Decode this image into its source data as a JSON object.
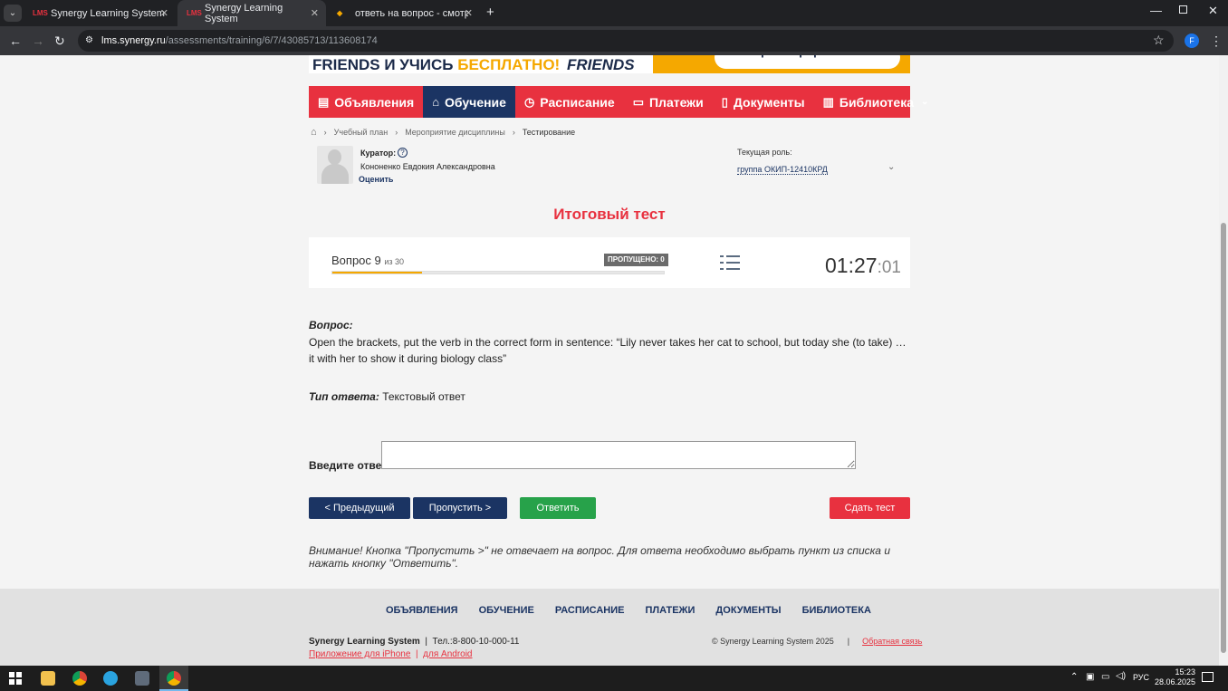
{
  "browser": {
    "tabs": [
      {
        "label": "Synergy Learning System",
        "favicon": "LMS"
      },
      {
        "label": "Synergy Learning System",
        "favicon": "LMS"
      },
      {
        "label": "ответь на вопрос - смотреть с"
      }
    ],
    "url_host": "lms.synergy.ru",
    "url_path": "/assessments/training/6/7/43085713/113608174",
    "profile_initial": "F"
  },
  "banner": {
    "text_main": "FRIENDS И УЧИСЬ ",
    "text_accent": "БЕСПЛАТНО!",
    "logo": "FRIENDS",
    "button": "Зарегистрироваться"
  },
  "nav": {
    "items": [
      {
        "label": "Объявления",
        "icon": "announcements-icon"
      },
      {
        "label": "Обучение",
        "icon": "graduation-cap-icon"
      },
      {
        "label": "Расписание",
        "icon": "clock-icon"
      },
      {
        "label": "Платежи",
        "icon": "payment-icon"
      },
      {
        "label": "Документы",
        "icon": "document-icon"
      },
      {
        "label": "Библиотека",
        "icon": "book-icon"
      }
    ]
  },
  "breadcrumb": {
    "items": [
      "Учебный план",
      "Мероприятие дисциплины",
      "Тестирование"
    ]
  },
  "curator": {
    "label": "Куратор:",
    "name": "Кононенко Евдокия Александровна",
    "rate": "Оценить"
  },
  "role": {
    "label": "Текущая роль:",
    "value": "группа ОКИП-12410КРД"
  },
  "test": {
    "title": "Итоговый тест",
    "question_label": "Вопрос 9",
    "question_total": "из 30",
    "skipped": "ПРОПУЩЕНО: 0",
    "progress": 0.27,
    "timer_main": "01:27",
    "timer_sec": ":01"
  },
  "question": {
    "label": "Вопрос:",
    "text": "Open the brackets, put the verb in the correct form in sentence: “Lily never takes her cat to school, but today she (to take) … it with her to show it during biology class”",
    "answer_type_label": "Тип ответа:",
    "answer_type": "Текстовый ответ",
    "answer_label": "Введите ответ:",
    "answer_value": ""
  },
  "buttons": {
    "prev": "< Предыдущий",
    "skip": "Пропустить >",
    "answer": "Ответить",
    "submit": "Сдать тест"
  },
  "notice": "Внимание! Кнопка \"Пропустить >\" не отвечает на вопрос. Для ответа необходимо выбрать пункт из списка и нажать кнопку \"Ответить\".",
  "footer": {
    "nav": [
      "ОБЪЯВЛЕНИЯ",
      "ОБУЧЕНИЕ",
      "РАСПИСАНИЕ",
      "ПЛАТЕЖИ",
      "ДОКУМЕНТЫ",
      "БИБЛИОТЕКА"
    ],
    "brand": "Synergy Learning System",
    "phone": "Тел.:8-800-10-000-11",
    "iphone": "Приложение для iPhone",
    "android": "для Android",
    "copyright": "© Synergy Learning System 2025",
    "feedback": "Обратная связь"
  },
  "taskbar": {
    "lang": "РУС",
    "time": "15:23",
    "date": "28.06.2025"
  },
  "colors": {
    "brand_red": "#e8313f",
    "brand_navy": "#1b3463",
    "accent_yellow": "#f5a800",
    "answer_green": "#27a24a"
  }
}
